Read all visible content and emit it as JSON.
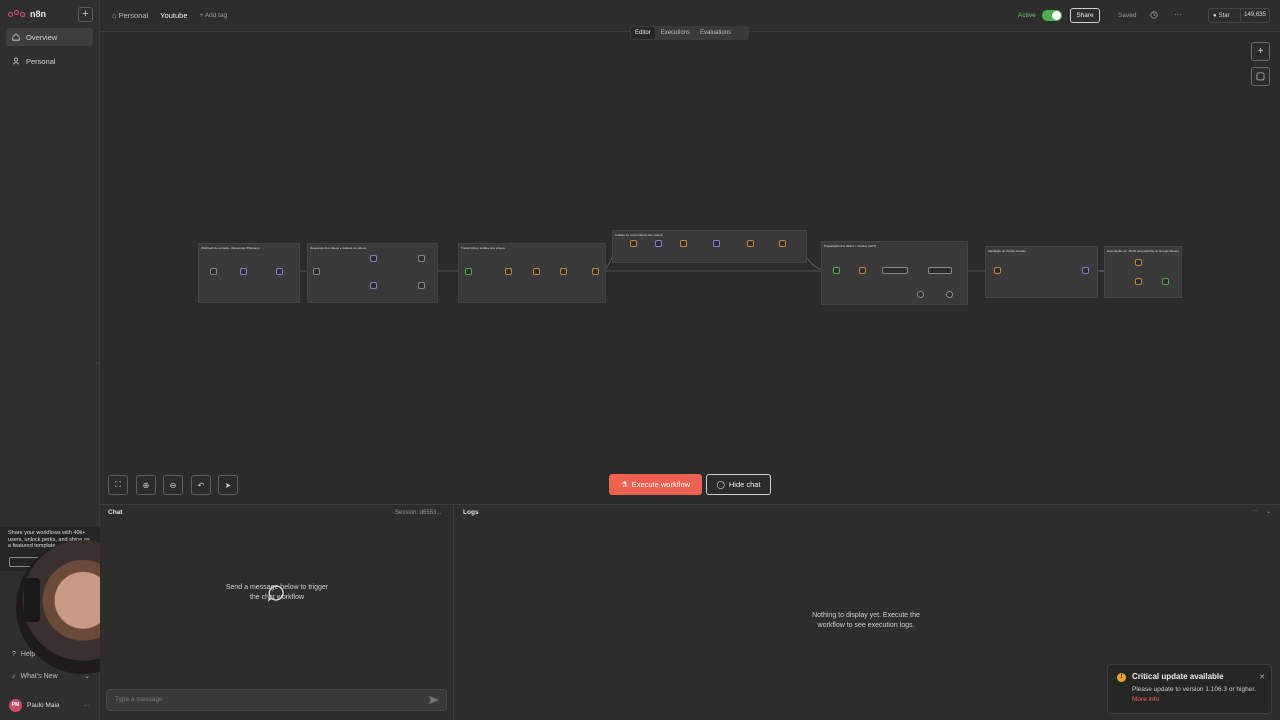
{
  "app": {
    "name": "n8n"
  },
  "sidebar": {
    "items": [
      {
        "label": "Overview",
        "icon": "home-icon",
        "active": true
      },
      {
        "label": "Personal",
        "icon": "user-icon",
        "active": false
      }
    ],
    "promo_text": "Share your workflows with 40k+ users, unlock perks, and shine as a featured template",
    "help_label": "Help",
    "whats_new_label": "What's New",
    "user": {
      "initials": "PM",
      "name": "Paulo Maia"
    }
  },
  "header": {
    "project": "Personal",
    "workflow_title": "Youtube",
    "add_tag": "+ Add tag",
    "active_label": "Active",
    "share_label": "Share",
    "saved_label": "Saved",
    "star_label": "Star",
    "star_count": "149,635"
  },
  "tabs": [
    {
      "label": "Editor",
      "active": true
    },
    {
      "label": "Executions",
      "active": false
    },
    {
      "label": "Evaluations",
      "active": false
    }
  ],
  "canvas": {
    "groups": [
      "Webhook de entrada - Responde Whatsapp",
      "Responde dos vídeos e dataset de vídeos",
      "Transcrição e análise dos vídeos",
      "Análise de concorrência dos vídeos",
      "Preparação dos dados + Análise (GPT)",
      "Validação do Output Gerado",
      "Exportação em JSON para planilha no Google Sheets"
    ],
    "execute_label": "Execute workflow",
    "hide_chat_label": "Hide chat"
  },
  "chat": {
    "title": "Chat",
    "session": "Session: d6553...",
    "empty_line1": "Send a message below to trigger",
    "empty_line2": "the chat workflow",
    "input_placeholder": "Type a message"
  },
  "logs": {
    "title": "Logs",
    "empty_line1": "Nothing to display yet. Execute the",
    "empty_line2": "workflow to see execution logs."
  },
  "toast": {
    "title": "Critical update available",
    "body": "Please update to version 1.106.3 or higher.",
    "link": "More info"
  },
  "colors": {
    "accent": "#ef6150",
    "active": "#4caf50",
    "brand": "#ea4b71"
  }
}
